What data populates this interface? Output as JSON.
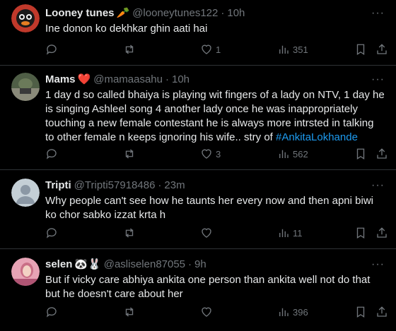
{
  "tweets": [
    {
      "name": "Looney tunes",
      "badge": "🥕",
      "handle": "@looneytunes122",
      "dot": "·",
      "time": "10h",
      "text": "Ine donon ko dekhkar ghin aati hai",
      "replies": "",
      "retweets": "",
      "likes": "1",
      "views": "351",
      "avatar_color": "#c0392b"
    },
    {
      "name": "Mams",
      "badge": "❤️",
      "handle": "@mamaasahu",
      "dot": "·",
      "time": "10h",
      "text": "1 day d so called bhaiya is playing wit fingers of a lady on NTV, 1 day he is singing Ashleel song 4 another lady once he was inappropriately touching a new female contestant he is always more intrsted in talking to other female n keeps ignoring his wife.. stry of ",
      "hashtag": "#AnkitaLokhande",
      "replies": "",
      "retweets": "",
      "likes": "3",
      "views": "562",
      "avatar_color": "#5a6b4f"
    },
    {
      "name": "Tripti",
      "badge": "",
      "handle": "@Tripti57918486",
      "dot": "·",
      "time": "23m",
      "text": "Why people can't see how he taunts her every now and then apni biwi ko chor sabko izzat krta h",
      "replies": "",
      "retweets": "",
      "likes": "",
      "views": "11",
      "avatar_color": "#c4cfd6"
    },
    {
      "name": "selen",
      "badge": "🐼🐰",
      "handle": "@asliselen87055",
      "dot": "·",
      "time": "9h",
      "text": "But if vicky care abhiya ankita one person than ankita well not do that but he doesn't care about her",
      "replies": "",
      "retweets": "",
      "likes": "",
      "views": "396",
      "avatar_color": "#d98aa0"
    }
  ],
  "more_label": "···"
}
